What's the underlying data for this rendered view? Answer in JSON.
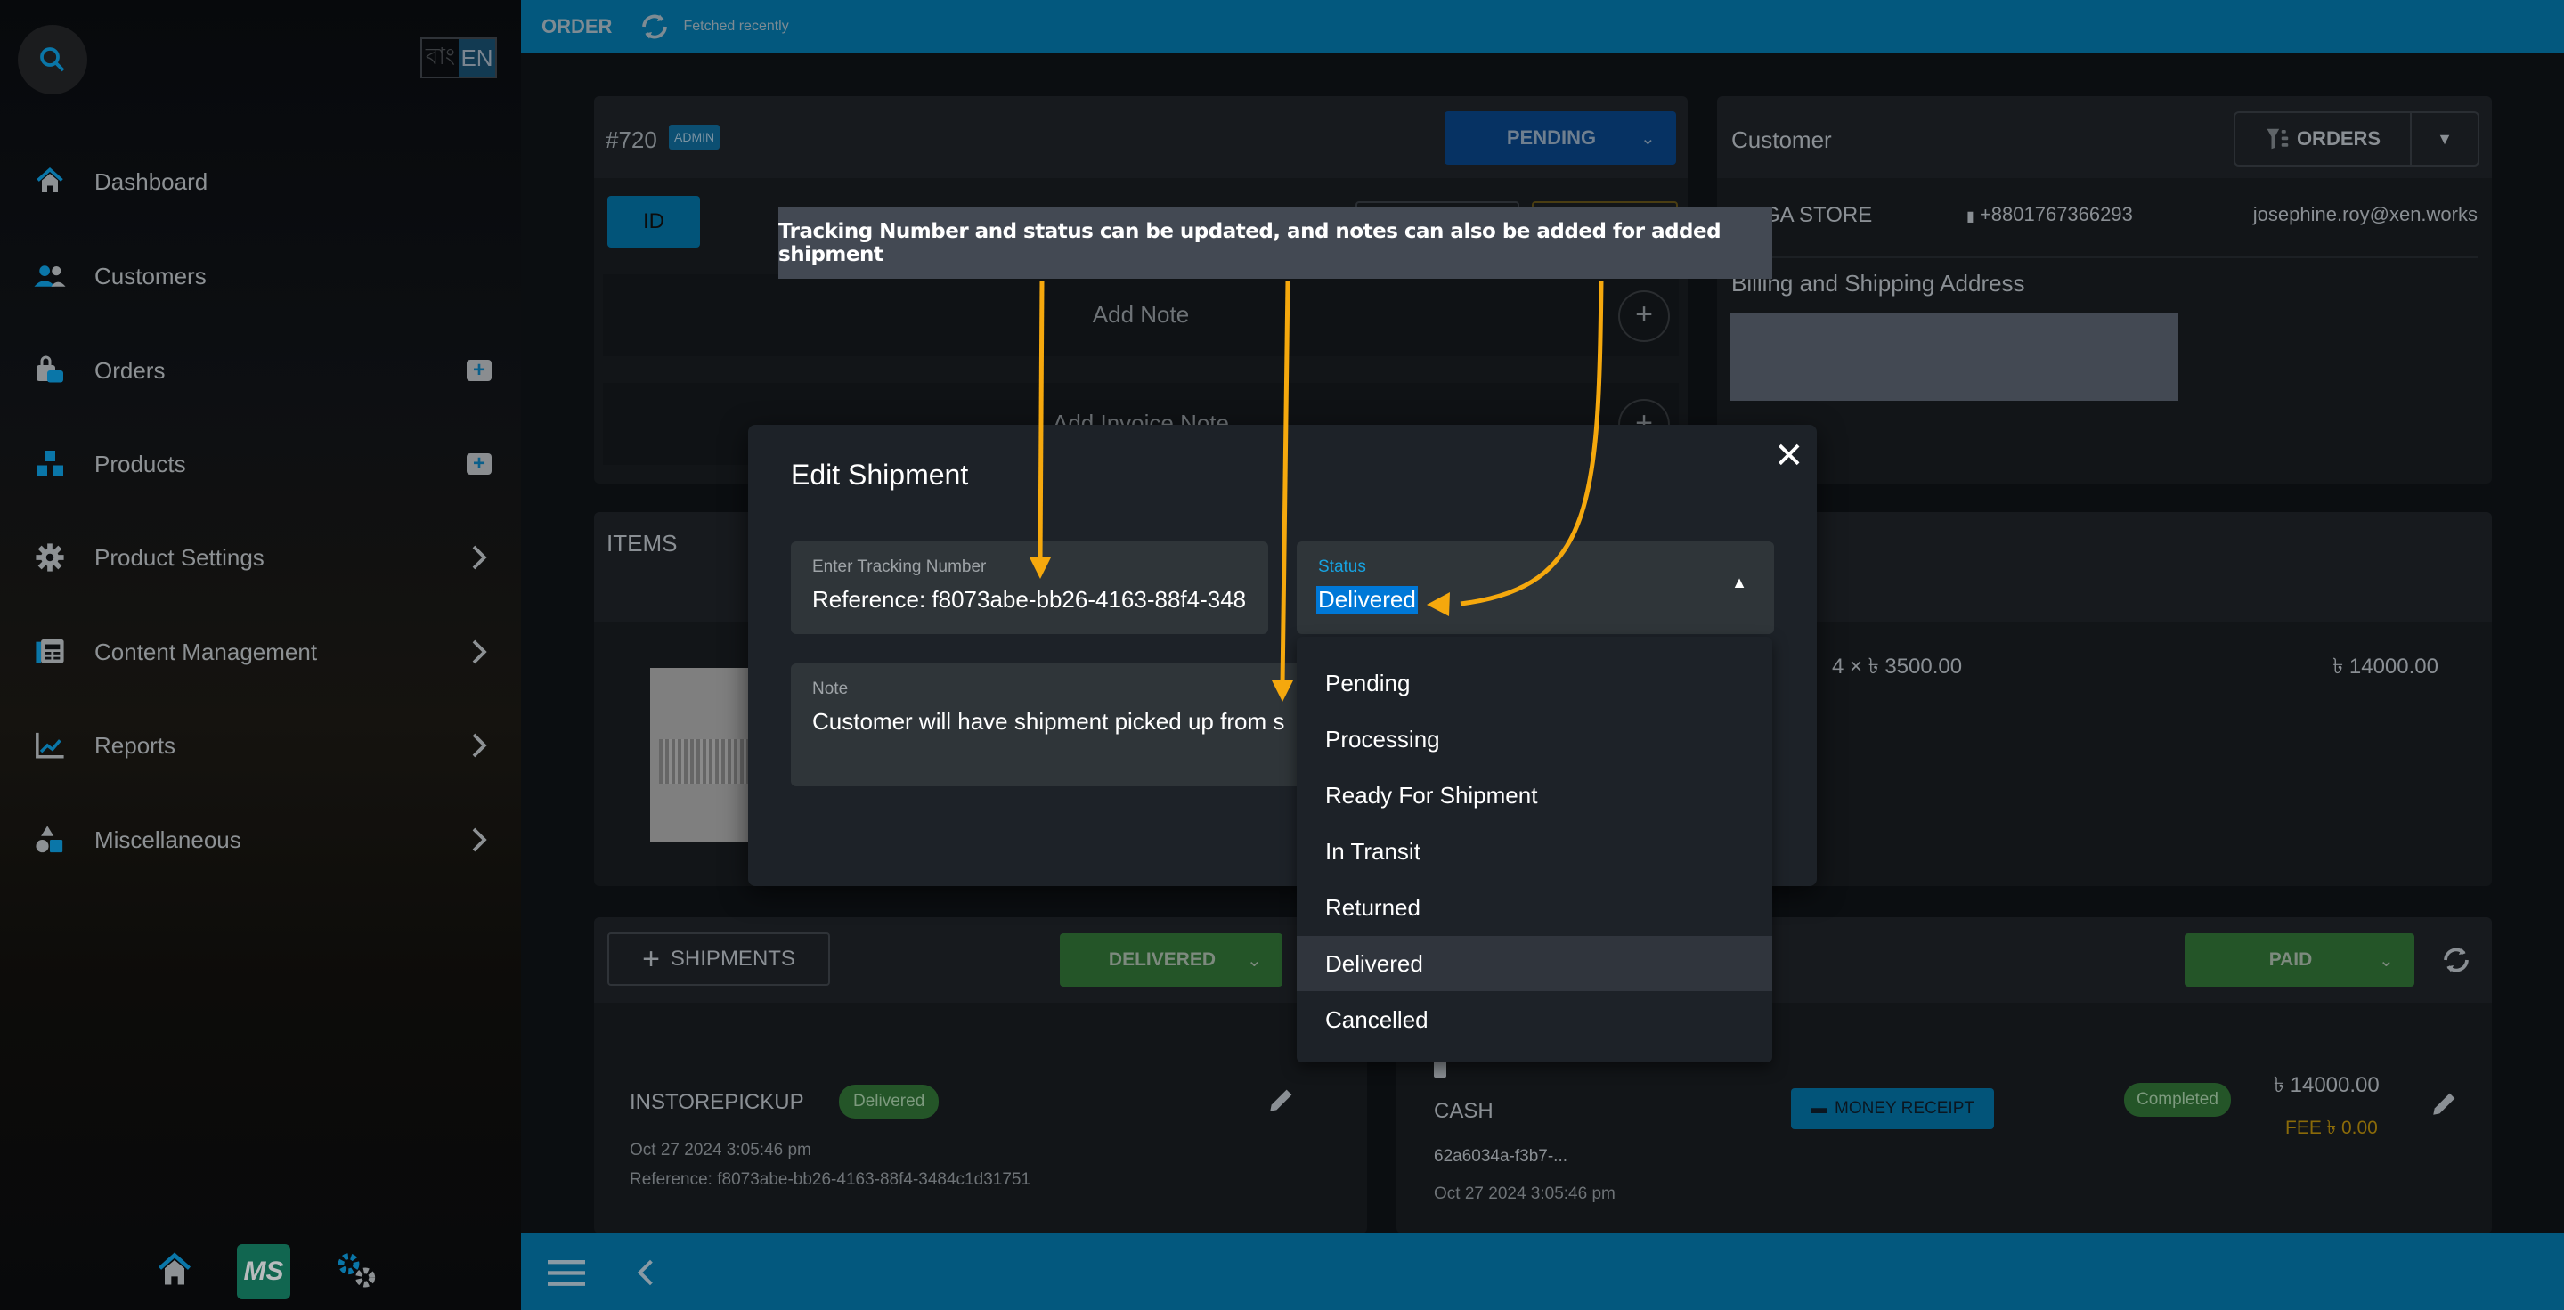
{
  "sidebar": {
    "language": {
      "bn": "বাং",
      "en": "EN"
    },
    "items": [
      {
        "label": "Dashboard",
        "icon": "home-icon",
        "trail": ""
      },
      {
        "label": "Customers",
        "icon": "customers-icon",
        "trail": ""
      },
      {
        "label": "Orders",
        "icon": "orders-bag-icon",
        "trail": "plus"
      },
      {
        "label": "Products",
        "icon": "products-boxes-icon",
        "trail": "plus"
      },
      {
        "label": "Product Settings",
        "icon": "gear-icon",
        "trail": "chevron"
      },
      {
        "label": "Content Management",
        "icon": "content-icon",
        "trail": "chevron"
      },
      {
        "label": "Reports",
        "icon": "chart-icon",
        "trail": "chevron"
      },
      {
        "label": "Miscellaneous",
        "icon": "shapes-icon",
        "trail": "chevron"
      }
    ],
    "footer": {
      "ms_label": "MS"
    }
  },
  "topbar": {
    "title": "ORDER",
    "fetched": "Fetched recently"
  },
  "order": {
    "number": "#720",
    "badge": "ADMIN",
    "status_button": "PENDING",
    "id_button": "ID",
    "add_note": "Add Note",
    "add_invoice_note": "Add Invoice Note"
  },
  "customer": {
    "title": "Customer",
    "orders_button": "ORDERS",
    "name": "MEGA STORE",
    "phone": "+8801767366293",
    "email": "josephine.roy@xen.works",
    "address_title": "Billing and Shipping Address"
  },
  "items": {
    "title": "ITEMS",
    "rows": [
      {
        "qty_price": "4 × ৳ 3500.00",
        "total": "৳ 14000.00"
      }
    ]
  },
  "shipments": {
    "add_button": "SHIPMENTS",
    "status_button": "DELIVERED",
    "entries": [
      {
        "method": "INSTOREPICKUP",
        "badge": "Delivered",
        "date": "Oct 27 2024 3:05:46 pm",
        "reference": "Reference: f8073abe-bb26-4163-88f4-3484c1d31751"
      }
    ]
  },
  "payments": {
    "status_button": "PAID",
    "entries": [
      {
        "method": "CASH",
        "id": "62a6034a-f3b7-...",
        "date": "Oct 27 2024 3:05:46 pm",
        "receipt_button": "MONEY RECEIPT",
        "badge": "Completed",
        "amount": "৳ 14000.00",
        "fee": "FEE ৳ 0.00"
      }
    ]
  },
  "modal": {
    "title": "Edit Shipment",
    "tracking": {
      "label": "Enter Tracking Number",
      "value": "Reference: f8073abe-bb26-4163-88f4-348"
    },
    "status": {
      "label": "Status",
      "value": "Delivered"
    },
    "note": {
      "label": "Note",
      "value": "Customer will have shipment picked up from s"
    },
    "status_options": [
      "Pending",
      "Processing",
      "Ready For Shipment",
      "In Transit",
      "Returned",
      "Delivered",
      "Cancelled"
    ],
    "selected_option": "Delivered"
  },
  "annotation": {
    "text": "Tracking Number and status can be updated, and notes can also be added for added shipment",
    "color": "#f5a80d"
  },
  "colors": {
    "accent": "#03587e",
    "selection": "#0078d7",
    "success": "#245528"
  }
}
